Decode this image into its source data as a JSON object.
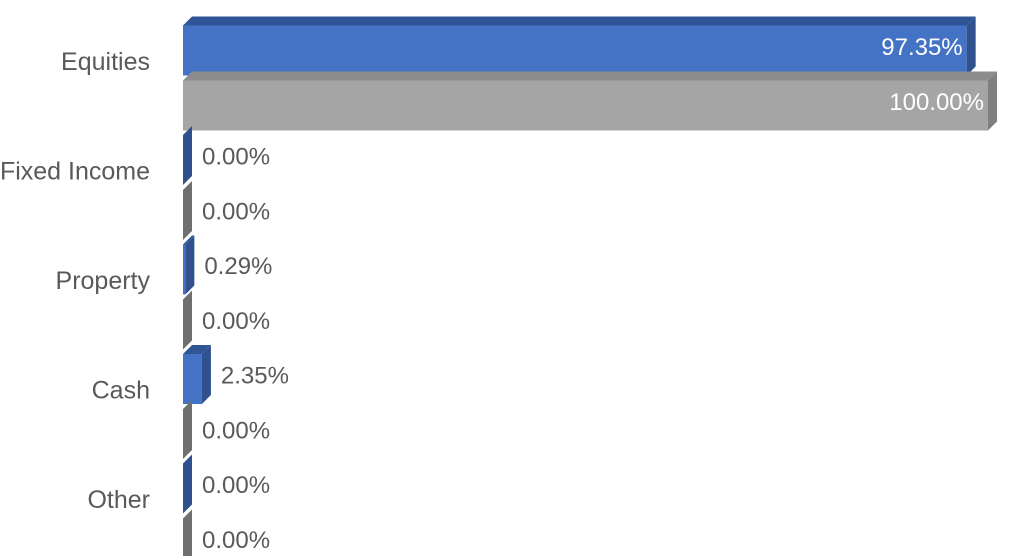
{
  "chart_data": {
    "type": "bar",
    "orientation": "horizontal",
    "style": "3d-clustered",
    "categories": [
      "Equities",
      "Fixed Income",
      "Property",
      "Cash",
      "Other"
    ],
    "series": [
      {
        "name": "Series 1",
        "color": "#4472C4",
        "values": [
          97.35,
          0.0,
          0.29,
          2.35,
          0.0
        ],
        "labels": [
          "97.35%",
          "0.00%",
          "0.29%",
          "2.35%",
          "0.00%"
        ]
      },
      {
        "name": "Series 2",
        "color": "#A5A5A5",
        "values": [
          100.0,
          0.0,
          0.0,
          0.0,
          0.0
        ],
        "labels": [
          "100.00%",
          "0.00%",
          "0.00%",
          "0.00%",
          "0.00%"
        ]
      }
    ],
    "xlim": [
      0,
      100
    ],
    "grid": false,
    "legend": "none",
    "title": "",
    "xlabel": "",
    "ylabel": ""
  }
}
